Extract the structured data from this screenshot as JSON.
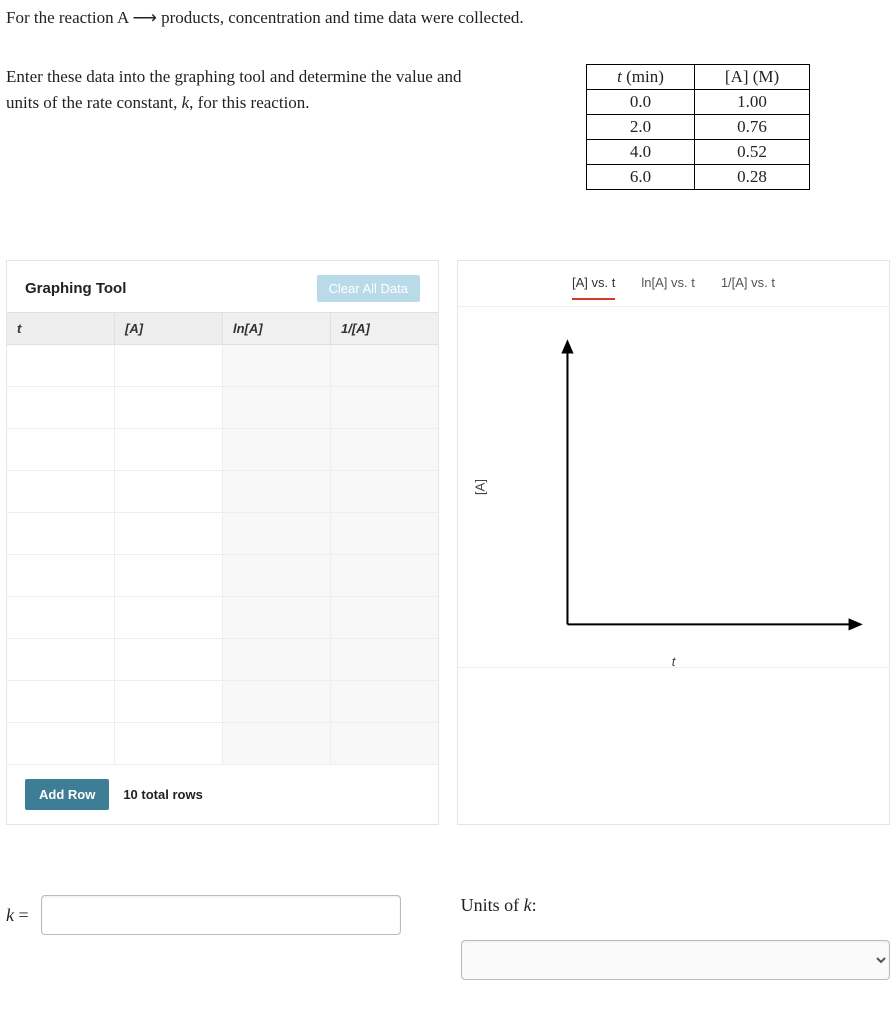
{
  "problem_intro": "For the reaction A ⟶ products, concentration and time data were collected.",
  "instructions": "Enter these data into the graphing tool and determine the value and units of the rate constant, k, for this reaction.",
  "data_table": {
    "headers": {
      "t": "t (min)",
      "A": "[A] (M)"
    },
    "rows": [
      {
        "t": "0.0",
        "A": "1.00"
      },
      {
        "t": "2.0",
        "A": "0.76"
      },
      {
        "t": "4.0",
        "A": "0.52"
      },
      {
        "t": "6.0",
        "A": "0.28"
      }
    ]
  },
  "graphing_tool": {
    "title": "Graphing Tool",
    "clear_label": "Clear All Data",
    "columns": {
      "t": "t",
      "A": "[A]",
      "lnA": "ln[A]",
      "invA": "1/[A]"
    },
    "blank_row_count": 10,
    "add_row_label": "Add Row",
    "row_count_label": "10 total rows"
  },
  "plot": {
    "tabs": {
      "t0": "[A] vs. t",
      "t1": "ln[A] vs. t",
      "t2": "1/[A] vs. t"
    },
    "y_label": "[A]",
    "x_label": "t"
  },
  "answer": {
    "k_label": "k =",
    "units_label": "Units of k:"
  }
}
